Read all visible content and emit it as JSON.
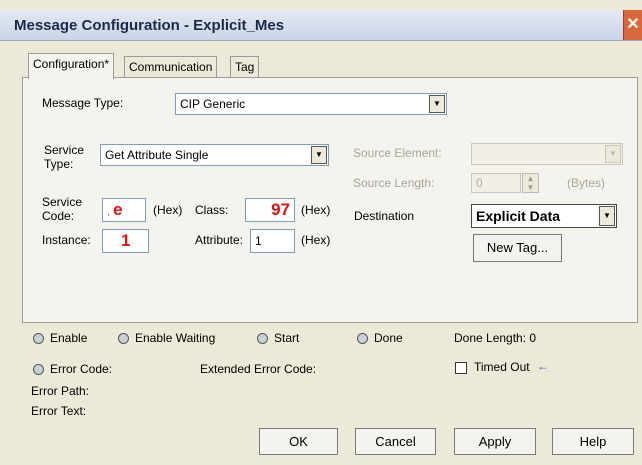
{
  "window": {
    "title": "Message Configuration - Explicit_Mes",
    "close_glyph": "✕"
  },
  "tabs": [
    {
      "label": "Configuration*"
    },
    {
      "label": "Communication"
    },
    {
      "label": "Tag"
    }
  ],
  "config": {
    "message_type_label": "Message Type:",
    "message_type_value": "CIP Generic",
    "service_type_label": "Service\nType:",
    "service_type_value": "Get Attribute Single",
    "service_code_label": "Service\nCode:",
    "service_code_value": "e",
    "service_code_prefix": ",",
    "hex_label": "(Hex)",
    "class_label": "Class:",
    "class_value": "97",
    "instance_label": "Instance:",
    "instance_value": "1",
    "attribute_label": "Attribute:",
    "attribute_value": "1",
    "source_element_label": "Source Element:",
    "source_length_label": "Source Length:",
    "source_length_value": "0",
    "bytes_label": "(Bytes)",
    "destination_label": "Destination",
    "destination_value": "Explicit Data",
    "new_tag_label": "New Tag..."
  },
  "status": {
    "enable": "Enable",
    "enable_waiting": "Enable Waiting",
    "start": "Start",
    "done": "Done",
    "done_length": "Done Length: 0",
    "error_code": "Error Code:",
    "extended_error_code": "Extended Error Code:",
    "timed_out": "Timed Out",
    "timed_out_arrow": "←",
    "error_path": "Error Path:",
    "error_text": "Error Text:"
  },
  "buttons": {
    "ok": "OK",
    "cancel": "Cancel",
    "apply": "Apply",
    "help": "Help"
  },
  "colors": {
    "accent_red": "#e01010",
    "title_text": "#1b2a4a"
  }
}
